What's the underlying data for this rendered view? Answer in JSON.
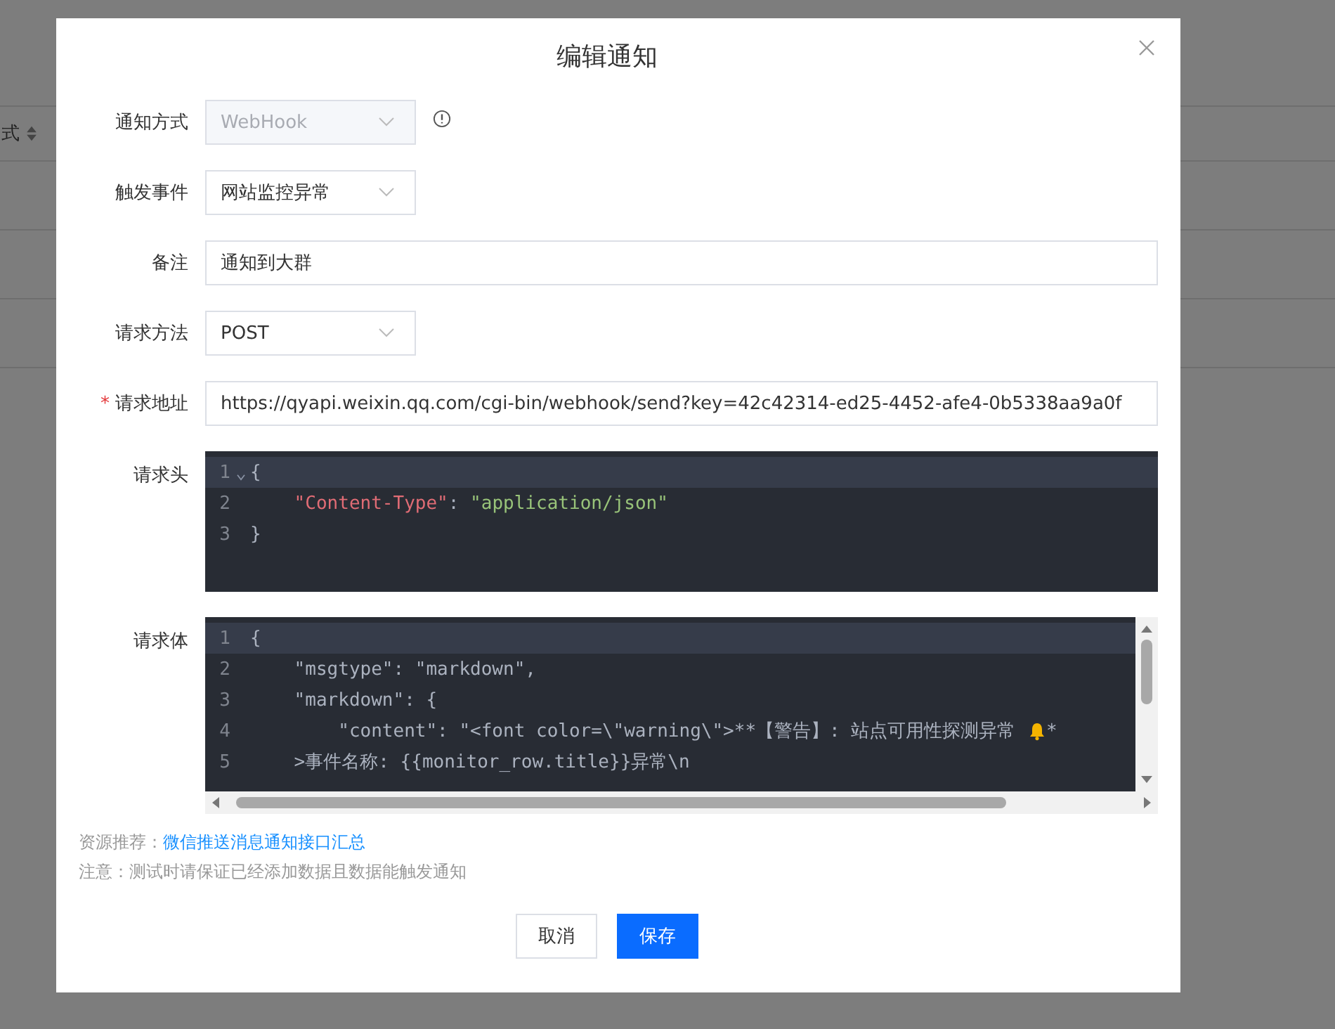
{
  "background": {
    "column_header": "式"
  },
  "dialog": {
    "title": "编辑通知"
  },
  "form": [
    {
      "kind": "select",
      "label": "通知方式",
      "value": "WebHook",
      "disabled": true,
      "required": false,
      "info": true
    },
    {
      "kind": "select",
      "label": "触发事件",
      "value": "网站监控异常",
      "disabled": false,
      "required": false,
      "info": false
    },
    {
      "kind": "input",
      "label": "备注",
      "value": "通知到大群",
      "disabled": false,
      "required": false,
      "info": false
    },
    {
      "kind": "select",
      "label": "请求方法",
      "value": "POST",
      "disabled": false,
      "required": false,
      "info": false
    },
    {
      "kind": "input",
      "label": "请求地址",
      "value": "https://qyapi.weixin.qq.com/cgi-bin/webhook/send?key=42c42314-ed25-4452-afe4-0b5338aa9a0f",
      "disabled": false,
      "required": true,
      "info": false
    }
  ],
  "editors": [
    {
      "label": "请求头",
      "scrollbars": false,
      "lines": [
        {
          "number": "1",
          "fold": true,
          "active": true,
          "tokens": [
            {
              "kind": "plain",
              "text": "{"
            }
          ]
        },
        {
          "number": "2",
          "active": false,
          "tokens": [
            {
              "kind": "key",
              "text": "    \"Content-Type\""
            },
            {
              "kind": "plain",
              "text": ": "
            },
            {
              "kind": "string",
              "text": "\"application/json\""
            }
          ]
        },
        {
          "number": "3",
          "active": false,
          "tokens": [
            {
              "kind": "plain",
              "text": "}"
            }
          ]
        }
      ]
    },
    {
      "label": "请求体",
      "scrollbars": true,
      "lines": [
        {
          "number": "1",
          "active": true,
          "tokens": [
            {
              "kind": "plain",
              "text": "{"
            }
          ]
        },
        {
          "number": "2",
          "active": false,
          "tokens": [
            {
              "kind": "plain",
              "text": "    \"msgtype\": \"markdown\","
            }
          ]
        },
        {
          "number": "3",
          "active": false,
          "tokens": [
            {
              "kind": "plain",
              "text": "    \"markdown\": {"
            }
          ]
        },
        {
          "number": "4",
          "active": false,
          "tokens": [
            {
              "kind": "plain",
              "text": "        \"content\": \"<font color=\\\"warning\\\">**【警告】: 站点可用性探测异常 "
            },
            {
              "kind": "bell"
            },
            {
              "kind": "plain",
              "text": "*"
            }
          ]
        },
        {
          "number": "5",
          "active": false,
          "tokens": [
            {
              "kind": "plain",
              "text": "    >事件名称: {{monitor_row.title}}异常\\n"
            }
          ]
        }
      ]
    }
  ],
  "notes": [
    {
      "label": "资源推荐：",
      "link": "微信推送消息通知接口汇总"
    },
    {
      "label": "注意：测试时请保证已经添加数据且数据能触发通知"
    }
  ],
  "buttons": [
    {
      "label": "取消",
      "primary": false
    },
    {
      "label": "保存",
      "primary": true
    }
  ]
}
